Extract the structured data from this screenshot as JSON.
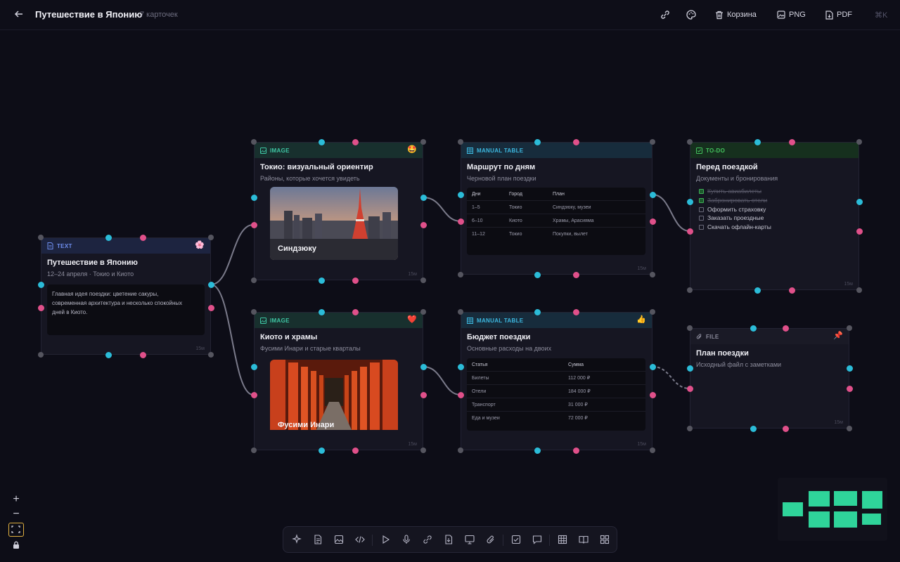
{
  "header": {
    "title": "Путешествие в Японию",
    "count": "7 карточек",
    "actions": {
      "trash": "Корзина",
      "png": "PNG",
      "pdf": "PDF",
      "shortcut": "⌘K"
    }
  },
  "cards": {
    "text": {
      "type": "TEXT",
      "emoji": "🌸",
      "title": "Путешествие в Японию",
      "subtitle": "12–24 апреля · Токио и Киото",
      "body": "Главная идея поездки: цветение сакуры, современная архитектура и несколько спокойных дней в Киото.",
      "age": "15м"
    },
    "image_tokyo": {
      "type": "IMAGE",
      "emoji": "🤩",
      "title": "Токио: визуальный ориентир",
      "subtitle": "Районы, которые хочется увидеть",
      "caption": "Синдзюку",
      "age": "15м"
    },
    "image_kyoto": {
      "type": "IMAGE",
      "emoji": "❤️",
      "title": "Киото и храмы",
      "subtitle": "Фусими Инари и старые кварталы",
      "caption": "Фусими Инари",
      "age": "15м"
    },
    "table_route": {
      "type": "MANUAL TABLE",
      "title": "Маршрут по дням",
      "subtitle": "Черновой план поездки",
      "columns": [
        "Дни",
        "Город",
        "План"
      ],
      "rows": [
        [
          "1–5",
          "Токио",
          "Синдзюку, музеи"
        ],
        [
          "6–10",
          "Киото",
          "Храмы, Арасияма"
        ],
        [
          "11–12",
          "Токио",
          "Покупки, вылет"
        ]
      ],
      "age": "15м"
    },
    "table_budget": {
      "type": "MANUAL TABLE",
      "emoji": "👍",
      "title": "Бюджет поездки",
      "subtitle": "Основные расходы на двоих",
      "columns": [
        "Статья",
        "Сумма"
      ],
      "rows": [
        [
          "Билеты",
          "112 000 ₽"
        ],
        [
          "Отели",
          "184 000 ₽"
        ],
        [
          "Транспорт",
          "31 000 ₽"
        ],
        [
          "Еда и музеи",
          "72 000 ₽"
        ]
      ],
      "age": "15м"
    },
    "todo": {
      "type": "TO-DO",
      "title": "Перед поездкой",
      "subtitle": "Документы и бронирования",
      "items": [
        {
          "label": "Купить авиабилеты",
          "done": true
        },
        {
          "label": "Забронировать отели",
          "done": true
        },
        {
          "label": "Оформить страховку",
          "done": false
        },
        {
          "label": "Заказать проездные",
          "done": false
        },
        {
          "label": "Скачать офлайн-карты",
          "done": false
        }
      ],
      "age": "15м"
    },
    "file": {
      "type": "FILE",
      "emoji": "📌",
      "title": "План поездки",
      "subtitle": "Исходный файл с заметками",
      "age": "15м"
    }
  },
  "zoom": {
    "in": "+",
    "out": "−"
  },
  "colors": {
    "background": "#0d0d17",
    "connector_cyan": "#2bbcd8",
    "connector_pink": "#e0508a",
    "minimap": "#2fd49a"
  }
}
